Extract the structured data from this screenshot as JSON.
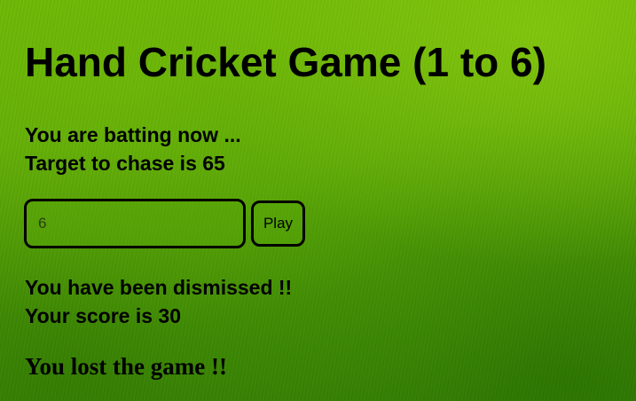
{
  "game": {
    "title": "Hand Cricket Game (1 to 6)",
    "status": {
      "batting": "You are batting now ...",
      "target": "Target to chase is 65"
    },
    "input": {
      "value": "6",
      "placeholder": ""
    },
    "play_button": "Play",
    "result": {
      "dismissed": "You have been dismissed !!",
      "score": "Your score is 30"
    },
    "final_message": "You lost the game !!"
  },
  "colors": {
    "background": "#5aab08",
    "text": "#000000",
    "border": "#000000"
  }
}
